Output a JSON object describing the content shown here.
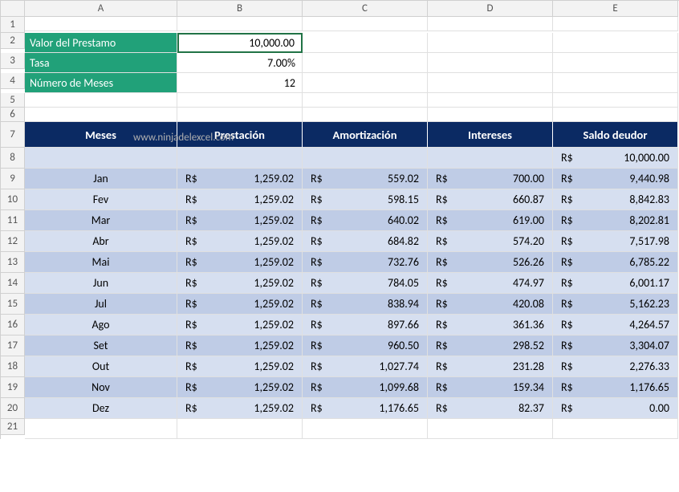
{
  "columns": [
    "A",
    "B",
    "C",
    "D",
    "E"
  ],
  "watermark": "www.ninjadelexcel.com",
  "inputs": {
    "loan_label": "Valor del Prestamo",
    "loan_value": "10,000.00",
    "rate_label": "Tasa",
    "rate_value": "7.00%",
    "months_label": "Número de Meses",
    "months_value": "12"
  },
  "table_headers": {
    "meses": "Meses",
    "prestacion": "Prestación",
    "amortizacion": "Amortización",
    "intereses": "Intereses",
    "saldo": "Saldo deudor"
  },
  "currency": "R$",
  "initial_balance": "10,000.00",
  "rows": [
    {
      "m": "Jan",
      "p": "1,259.02",
      "a": "559.02",
      "i": "700.00",
      "s": "9,440.98"
    },
    {
      "m": "Fev",
      "p": "1,259.02",
      "a": "598.15",
      "i": "660.87",
      "s": "8,842.83"
    },
    {
      "m": "Mar",
      "p": "1,259.02",
      "a": "640.02",
      "i": "619.00",
      "s": "8,202.81"
    },
    {
      "m": "Abr",
      "p": "1,259.02",
      "a": "684.82",
      "i": "574.20",
      "s": "7,517.98"
    },
    {
      "m": "Mai",
      "p": "1,259.02",
      "a": "732.76",
      "i": "526.26",
      "s": "6,785.22"
    },
    {
      "m": "Jun",
      "p": "1,259.02",
      "a": "784.05",
      "i": "474.97",
      "s": "6,001.17"
    },
    {
      "m": "Jul",
      "p": "1,259.02",
      "a": "838.94",
      "i": "420.08",
      "s": "5,162.23"
    },
    {
      "m": "Ago",
      "p": "1,259.02",
      "a": "897.66",
      "i": "361.36",
      "s": "4,264.57"
    },
    {
      "m": "Set",
      "p": "1,259.02",
      "a": "960.50",
      "i": "298.52",
      "s": "3,304.07"
    },
    {
      "m": "Out",
      "p": "1,259.02",
      "a": "1,027.74",
      "i": "231.28",
      "s": "2,276.33"
    },
    {
      "m": "Nov",
      "p": "1,259.02",
      "a": "1,099.68",
      "i": "159.34",
      "s": "1,176.65"
    },
    {
      "m": "Dez",
      "p": "1,259.02",
      "a": "1,176.65",
      "i": "82.37",
      "s": "0.00"
    }
  ]
}
